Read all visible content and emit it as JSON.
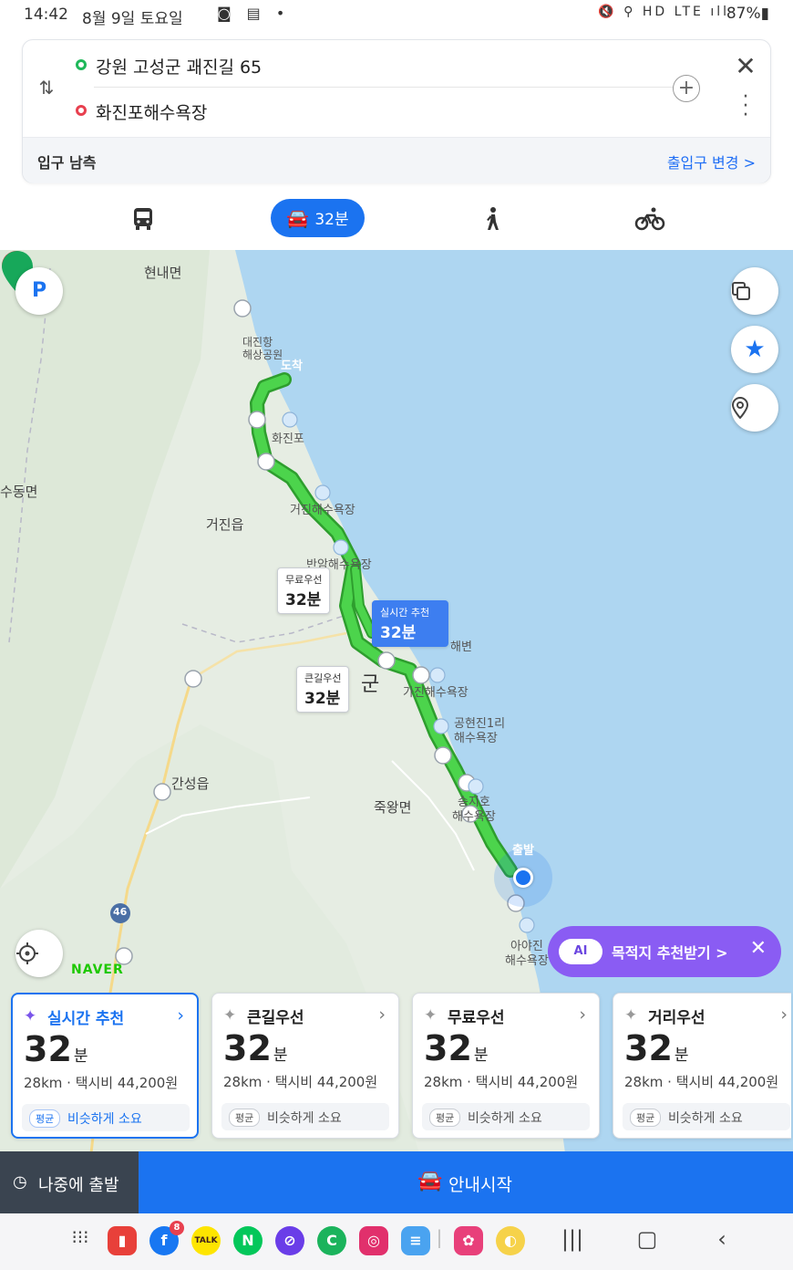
{
  "status_bar": {
    "time": "14:42",
    "date": "8월 9일 토요일",
    "left_icons": "◙ ▤ •",
    "right_icons": "🔇 ⚲ HD LTE ıll",
    "battery": "87%▮"
  },
  "route": {
    "origin": "강원 고성군 괘진길 65",
    "destination": "화진포해수욕장",
    "entrance_label": "입구 남측",
    "entrance_change": "출입구 변경 >"
  },
  "modes": {
    "car_time": "32분"
  },
  "map": {
    "labels": {
      "hyeonnae": "현내면",
      "daejin": "대진항\n해상공원",
      "hwajinpo": "화진포",
      "sudong": "수동면",
      "geojin": "거진읍",
      "geojin_beach": "거진해수욕장",
      "banam_beach": "반암해수욕장",
      "gun": "군",
      "gajin_beach": "가진해수욕장",
      "haebyeon": "해변",
      "gonghyeon": "공현진1리\n해수욕장",
      "ganseong": "간성읍",
      "jugwang": "죽왕면",
      "songjiho": "송지호\n해수욕장",
      "ayajin": "아야진\n해수욕장",
      "road_46": "46"
    },
    "route_boxes": {
      "free": {
        "title": "무료우선",
        "time": "32분"
      },
      "realtime": {
        "title": "실시간 추천",
        "time": "32분"
      },
      "main_road": {
        "title": "큰길우선",
        "time": "32분"
      }
    },
    "arrive_label": "도착",
    "start_label": "출발",
    "naver_logo": "NAVER",
    "ai_chip": {
      "badge": "AI",
      "text": "목적지 추천받기 >",
      "close": "✕"
    },
    "buttons": {
      "parking": "P"
    }
  },
  "cards": [
    {
      "title": "실시간 추천",
      "time": "32",
      "unit": "분",
      "info": "28km · 택시비 44,200원",
      "avg": "평균",
      "note": "비슷하게 소요"
    },
    {
      "title": "큰길우선",
      "time": "32",
      "unit": "분",
      "info": "28km · 택시비 44,200원",
      "avg": "평균",
      "note": "비슷하게 소요"
    },
    {
      "title": "무료우선",
      "time": "32",
      "unit": "분",
      "info": "28km · 택시비 44,200원",
      "avg": "평균",
      "note": "비슷하게 소요"
    },
    {
      "title": "거리우선",
      "time": "32",
      "unit": "분",
      "info": "28km · 택시비 44,200원",
      "avg": "평균",
      "note": "비슷하게 소요"
    }
  ],
  "actions": {
    "later": "나중에 출발",
    "start": "안내시작"
  },
  "dock": {
    "facebook_badge": "8",
    "apps": [
      "grid",
      "memo",
      "facebook",
      "kakaotalk",
      "naver",
      "browser",
      "kakao-c",
      "instagram",
      "mail",
      "flower",
      "misc"
    ],
    "kakaotalk_label": "TALK",
    "naver_label": "N",
    "kakao_c_label": "C"
  },
  "colors": {
    "accent": "#1b73f0",
    "route_green": "#3cc43c",
    "sea": "#aed6f1",
    "land": "#e9efe6",
    "ai_purple": "#8a5cf3"
  }
}
